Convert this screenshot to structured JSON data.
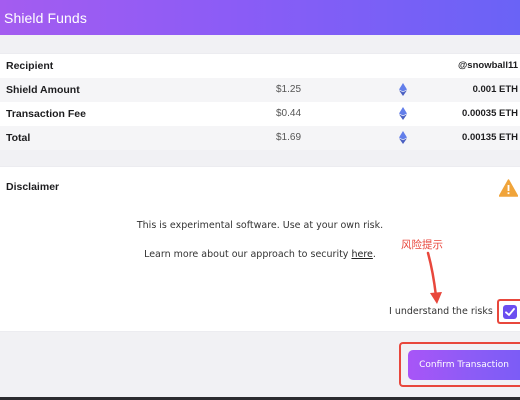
{
  "header": {
    "title": "Shield Funds"
  },
  "summary": {
    "recipient_label": "Recipient",
    "recipient_value": "@snowball11",
    "rows": [
      {
        "label": "Shield Amount",
        "usd": "$1.25",
        "amount": "0.001 ETH"
      },
      {
        "label": "Transaction Fee",
        "usd": "$0.44",
        "amount": "0.00035 ETH"
      },
      {
        "label": "Total",
        "usd": "$1.69",
        "amount": "0.00135 ETH"
      }
    ],
    "currency_icon": "ethereum-icon"
  },
  "disclaimer": {
    "title": "Disclaimer",
    "warning_icon": "warning-triangle-icon",
    "text1": "This is experimental software. Use at your own risk.",
    "text2_prefix": "Learn more about our approach to security ",
    "text2_link": "here",
    "text2_suffix": ".",
    "understand_label": "I understand the risks",
    "checkbox_checked": true
  },
  "annotation": {
    "text": "风险提示",
    "color": "#e8473c"
  },
  "actions": {
    "confirm_label": "Confirm Transaction"
  },
  "colors": {
    "accent": "#8b5cf6",
    "annotation": "#e8473c"
  }
}
